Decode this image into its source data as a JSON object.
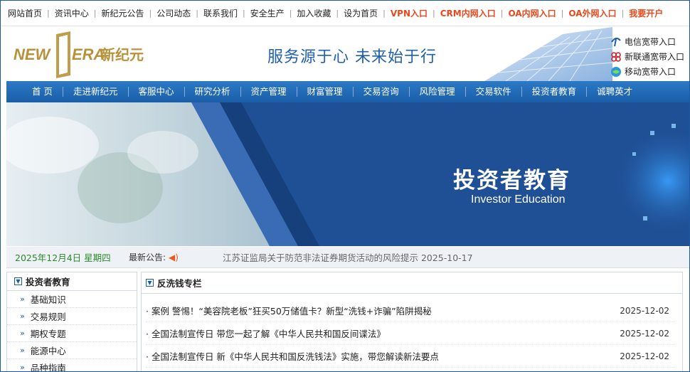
{
  "topbar": {
    "links": [
      {
        "label": "网站首页",
        "highlight": false
      },
      {
        "label": "资讯中心",
        "highlight": false
      },
      {
        "label": "新纪元公告",
        "highlight": false
      },
      {
        "label": "公司动态",
        "highlight": false
      },
      {
        "label": "联系我们",
        "highlight": false
      },
      {
        "label": "安全生产",
        "highlight": false
      },
      {
        "label": "加入收藏",
        "highlight": false
      },
      {
        "label": "设为首页",
        "highlight": false
      },
      {
        "label": "VPN入口",
        "highlight": true
      },
      {
        "label": "CRM内网入口",
        "highlight": true
      },
      {
        "label": "OA内网入口",
        "highlight": true
      },
      {
        "label": "OA外网入口",
        "highlight": true
      },
      {
        "label": "我要开户",
        "highlight": true
      }
    ]
  },
  "header": {
    "logo_latin_left": "NEW",
    "logo_latin_right": "ERA",
    "logo_cn": "新纪元",
    "slogan": "服务源于心  未来始于行",
    "isp_links": [
      {
        "label": "电信宽带入口",
        "icon": "telecom-icon"
      },
      {
        "label": "新联通宽带入口",
        "icon": "unicom-icon"
      },
      {
        "label": "移动宽带入口",
        "icon": "mobile-icon"
      }
    ]
  },
  "nav": {
    "items": [
      "首 页",
      "走进新纪元",
      "客服中心",
      "研究分析",
      "资产管理",
      "财富管理",
      "交易咨询",
      "风险管理",
      "交易软件",
      "投资者教育",
      "诚聘英才"
    ]
  },
  "banner": {
    "title": "投资者教育",
    "subtitle": "Investor Education"
  },
  "ticker": {
    "date": "2025年12月4日 星期四",
    "latest_label": "最新公告:",
    "text": "江苏证监局关于防范非法证券期货活动的风险提示 2025-10-17"
  },
  "side": {
    "title": "投资者教育",
    "items": [
      "基础知识",
      "交易规则",
      "期权专题",
      "能源中心",
      "品种指南"
    ]
  },
  "main": {
    "title": "反洗钱专栏",
    "news": [
      {
        "title": "· 案例 警惕！“美容院老板”狂买50万储值卡？新型“洗钱+诈骗”陷阱揭秘",
        "date": "2025-12-02"
      },
      {
        "title": "· 全国法制宣传日 带您一起了解《中华人民共和国反间谍法》",
        "date": "2025-12-02"
      },
      {
        "title": "· 全国法制宣传日 新《中华人民共和国反洗钱法》实施，带您解读新法要点",
        "date": "2025-12-02"
      }
    ]
  },
  "colors": {
    "brand_blue": "#1d5aa6",
    "highlight_orange": "#e8481c",
    "logo_gold": "#b8923a",
    "date_green": "#2a8a2a"
  }
}
